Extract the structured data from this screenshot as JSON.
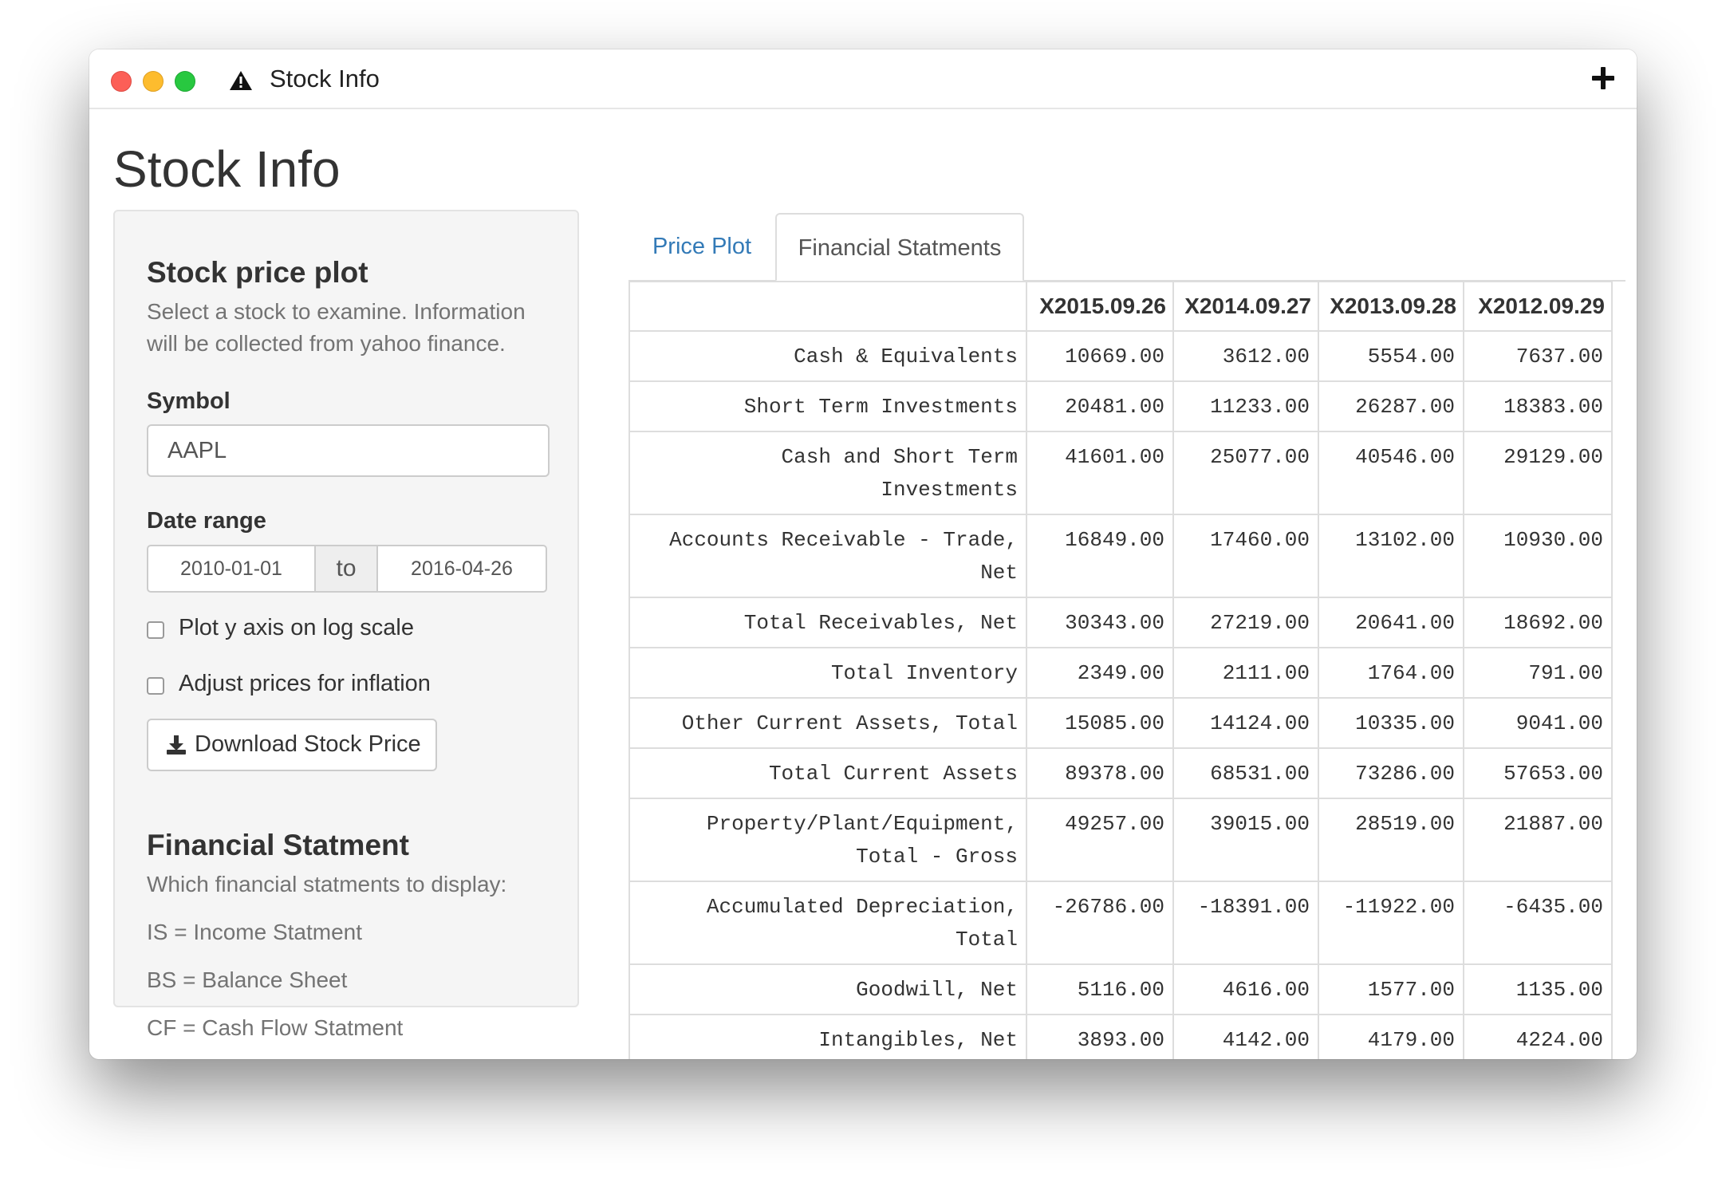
{
  "window": {
    "title": "Stock Info"
  },
  "page": {
    "title": "Stock Info"
  },
  "sidebar": {
    "plot_heading": "Stock price plot",
    "plot_help": "Select a stock to examine. Information will be collected from yahoo finance.",
    "symbol_label": "Symbol",
    "symbol_value": "AAPL",
    "date_label": "Date range",
    "date_start": "2010-01-01",
    "date_separator": "to",
    "date_end": "2016-04-26",
    "log_scale_label": "Plot y axis on log scale",
    "log_scale_checked": false,
    "inflation_label": "Adjust prices for inflation",
    "inflation_checked": false,
    "download_label": "Download Stock Price",
    "fin_heading": "Financial Statment",
    "fin_help": "Which financial statments to display:",
    "legend_is": "IS = Income Statment",
    "legend_bs": "BS = Balance Sheet",
    "legend_cf": "CF = Cash Flow Statment"
  },
  "tabs": [
    {
      "label": "Price Plot",
      "active": false
    },
    {
      "label": "Financial Statments",
      "active": true
    }
  ],
  "table": {
    "headers": [
      "",
      "X2015.09.26",
      "X2014.09.27",
      "X2013.09.28",
      "X2012.09.29"
    ],
    "rows": [
      {
        "label": "Cash & Equivalents",
        "values": [
          "10669.00",
          "3612.00",
          "5554.00",
          "7637.00"
        ]
      },
      {
        "label": "Short Term Investments",
        "values": [
          "20481.00",
          "11233.00",
          "26287.00",
          "18383.00"
        ]
      },
      {
        "label": "Cash and Short Term Investments",
        "values": [
          "41601.00",
          "25077.00",
          "40546.00",
          "29129.00"
        ]
      },
      {
        "label": "Accounts Receivable - Trade, Net",
        "values": [
          "16849.00",
          "17460.00",
          "13102.00",
          "10930.00"
        ]
      },
      {
        "label": "Total Receivables, Net",
        "values": [
          "30343.00",
          "27219.00",
          "20641.00",
          "18692.00"
        ]
      },
      {
        "label": "Total Inventory",
        "values": [
          "2349.00",
          "2111.00",
          "1764.00",
          "791.00"
        ]
      },
      {
        "label": "Other Current Assets, Total",
        "values": [
          "15085.00",
          "14124.00",
          "10335.00",
          "9041.00"
        ]
      },
      {
        "label": "Total Current Assets",
        "values": [
          "89378.00",
          "68531.00",
          "73286.00",
          "57653.00"
        ]
      },
      {
        "label": "Property/Plant/Equipment, Total - Gross",
        "values": [
          "49257.00",
          "39015.00",
          "28519.00",
          "21887.00"
        ]
      },
      {
        "label": "Accumulated Depreciation, Total",
        "values": [
          "-26786.00",
          "-18391.00",
          "-11922.00",
          "-6435.00"
        ]
      },
      {
        "label": "Goodwill, Net",
        "values": [
          "5116.00",
          "4616.00",
          "1577.00",
          "1135.00"
        ]
      },
      {
        "label": "Intangibles, Net",
        "values": [
          "3893.00",
          "4142.00",
          "4179.00",
          "4224.00"
        ]
      },
      {
        "label": "",
        "values": [
          "",
          "",
          "",
          ""
        ]
      }
    ]
  },
  "colors": {
    "link": "#337ab7",
    "close": "#fc5f57",
    "minimize": "#fdbc2e",
    "zoom": "#28c840"
  },
  "icons": [
    "warning-icon",
    "plus-icon",
    "download-icon"
  ]
}
